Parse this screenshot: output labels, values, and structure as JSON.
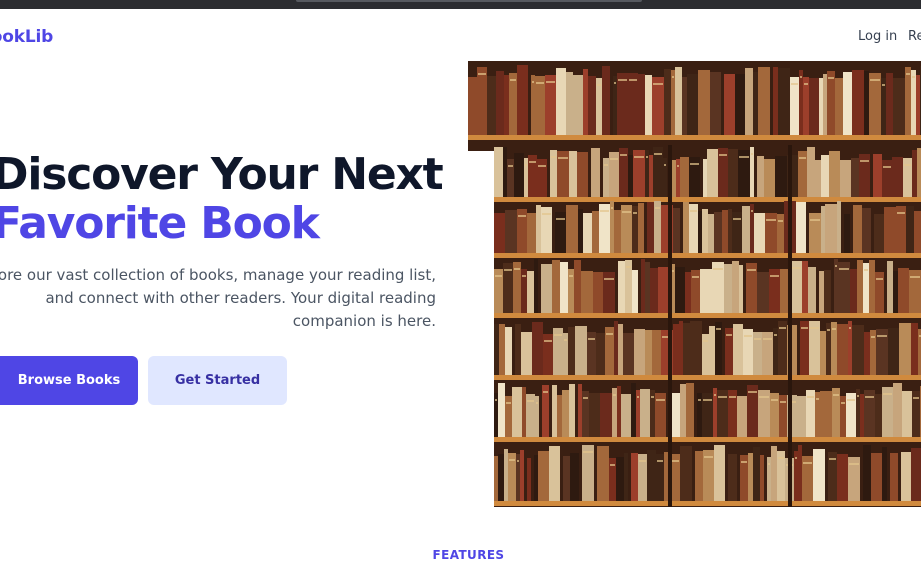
{
  "header": {
    "logo_text": "BookLib",
    "nav": {
      "login_label": "Log in",
      "register_label": "Register"
    }
  },
  "hero": {
    "title_line_1": "Discover Your Next",
    "title_line_2": "Favorite Book",
    "description": "Explore our vast collection of books, manage your reading list, and connect with other readers. Your digital reading companion is here.",
    "primary_button_label": "Browse Books",
    "secondary_button_label": "Get Started",
    "image_alt": "bookshelf-photo"
  },
  "features": {
    "label": "FEATURES"
  },
  "colors": {
    "accent": "#4f46e5",
    "accent_light": "#e0e7ff",
    "heading": "#0f172a",
    "body_text": "#4b5563"
  }
}
